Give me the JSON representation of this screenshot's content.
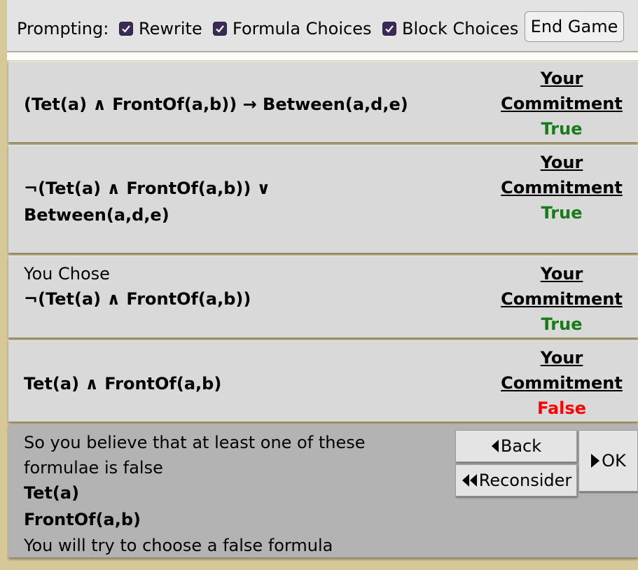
{
  "toolbar": {
    "prompting_label": "Prompting:",
    "checkboxes": [
      {
        "label": "Rewrite",
        "checked": true
      },
      {
        "label": "Formula Choices",
        "checked": true
      },
      {
        "label": "Block Choices",
        "checked": true
      }
    ],
    "end_game_label": "End Game"
  },
  "commitment_heading_1": "Your",
  "commitment_heading_2": "Commitment",
  "colors": {
    "true": "#1a7a1a",
    "false": "#ff0000",
    "checkbox": "#3b2a55"
  },
  "cards": [
    {
      "formula": "(Tet(a) ∧ FrontOf(a,b)) → Between(a,d,e)",
      "commitment": "True"
    },
    {
      "formula_line1": "¬(Tet(a) ∧ FrontOf(a,b)) ∨",
      "formula_line2": "Between(a,d,e)",
      "commitment": "True"
    },
    {
      "prefix": "You Chose",
      "formula": "¬(Tet(a) ∧ FrontOf(a,b))",
      "commitment": "True"
    },
    {
      "formula": "Tet(a) ∧ FrontOf(a,b)",
      "commitment": "False"
    }
  ],
  "message": {
    "line1": "So you believe that at least one of these",
    "line2": "formulae is false",
    "formula1": "Tet(a)",
    "formula2": "FrontOf(a,b)",
    "line3": "You will try to choose a false formula"
  },
  "buttons": {
    "back": "Back",
    "reconsider": "Reconsider",
    "ok": "OK"
  }
}
